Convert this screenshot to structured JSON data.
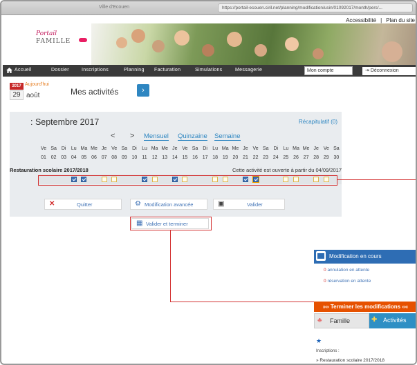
{
  "browser": {
    "tab_title": "Ville d'Ecouen",
    "url": "https://portail-ecouen.ciril.net/planning/modification/usin/01092017/month/pers/..."
  },
  "header": {
    "access_links": [
      "Accessibilité",
      "|",
      "Plan du site"
    ],
    "logo_top": "Portail",
    "logo_bottom": "FAMILLE"
  },
  "nav": {
    "items": [
      "Accueil",
      "Dossier",
      "Inscriptions",
      "Planning",
      "Facturation",
      "Simulations",
      "Messagerie"
    ],
    "account_label": "Mon compte",
    "logout_label": "Déconnexion"
  },
  "date": {
    "year": "2017",
    "today_label": "Aujourd'hui",
    "day": "29",
    "month": "août"
  },
  "page_title": "Mes activités",
  "planning": {
    "period": ": Septembre 2017",
    "recap_label": "Récapitulatif (0)",
    "prev": "<",
    "next": ">",
    "views": [
      "Mensuel",
      "Quinzaine",
      "Semaine"
    ],
    "day_letters": [
      "Ve",
      "Sa",
      "Di",
      "Lu",
      "Ma",
      "Me",
      "Je",
      "Ve",
      "Sa",
      "Di",
      "Lu",
      "Ma",
      "Me",
      "Je",
      "Ve",
      "Sa",
      "Di",
      "Lu",
      "Ma",
      "Me",
      "Je",
      "Ve",
      "Sa",
      "Di",
      "Lu",
      "Ma",
      "Me",
      "Je",
      "Ve",
      "Sa"
    ],
    "day_numbers": [
      "01",
      "02",
      "03",
      "04",
      "05",
      "06",
      "07",
      "08",
      "09",
      "10",
      "11",
      "12",
      "13",
      "14",
      "15",
      "16",
      "17",
      "18",
      "19",
      "20",
      "21",
      "22",
      "23",
      "24",
      "25",
      "26",
      "27",
      "28",
      "29",
      "30"
    ],
    "activity_name": "Restauration scolaire 2017/2018",
    "activity_note": "Cette activité est ouverte à partir du 04/09/2017",
    "day_states": [
      "none",
      "none",
      "none",
      "on",
      "on",
      "none",
      "off",
      "off",
      "none",
      "none",
      "on",
      "off",
      "none",
      "on",
      "off",
      "none",
      "none",
      "off",
      "off",
      "none",
      "on",
      "sel",
      "none",
      "none",
      "off",
      "off",
      "none",
      "off",
      "off",
      "none"
    ]
  },
  "buttons": {
    "quit": "Quitter",
    "advanced": "Modification avancée",
    "validate": "Valider",
    "validate_finish": "Valider et terminer"
  },
  "side_panel": {
    "title": "Modification en cours",
    "pending_cancel_count": "0",
    "pending_cancel_label": "annulation en attente",
    "pending_booking_count": "0",
    "pending_booking_label": "réservation en attente",
    "finish_label": "»» Terminer les modifications ««",
    "tab_family": "Famille",
    "tab_activities": "Activités",
    "inscriptions_label": "Inscriptions :",
    "inscription_item": "» Restauration scolaire 2017/2018"
  },
  "colors": {
    "accent_blue": "#2e86c1",
    "checked_blue": "#3f72b5",
    "highlight_red": "#d32f2f",
    "finish_orange": "#e65100",
    "nav_dark": "#3a3a3a"
  }
}
